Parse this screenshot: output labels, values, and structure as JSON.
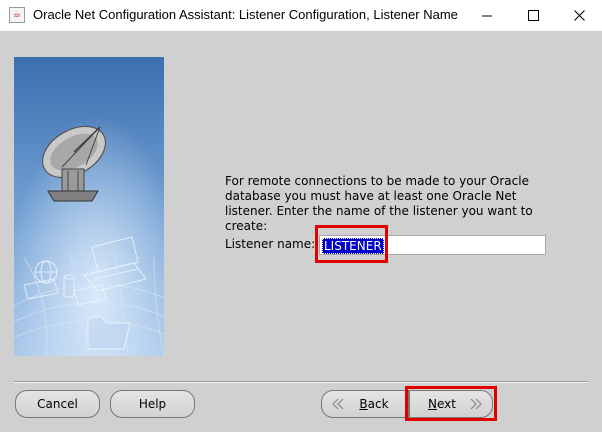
{
  "window": {
    "title": "Oracle Net Configuration Assistant: Listener Configuration, Listener Name"
  },
  "main": {
    "description": "For remote connections to be made to your Oracle database you must have at least one Oracle Net listener. Enter the name of the listener you want to create:",
    "listener_label": "Listener name:",
    "listener_value": "LISTENER"
  },
  "buttons": {
    "cancel": "Cancel",
    "help": "Help",
    "back": "Back",
    "next": "Next"
  },
  "icons": {
    "app": "java-icon",
    "minimize": "minimize-icon",
    "maximize": "maximize-icon",
    "close": "close-icon",
    "back": "chevron-double-left-icon",
    "next": "chevron-double-right-icon"
  },
  "colors": {
    "dialog_background": "#d0d0d0",
    "selection": "#0000c8",
    "highlight": "#e00000"
  }
}
